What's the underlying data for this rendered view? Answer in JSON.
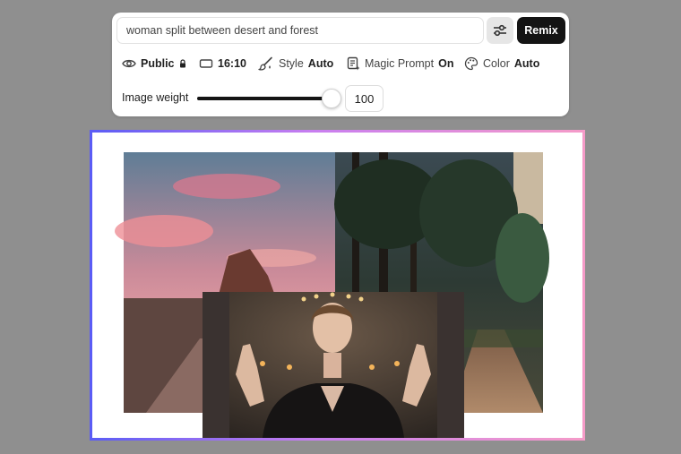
{
  "prompt": {
    "value": "woman split between desert and forest"
  },
  "toolbar": {
    "remix_label": "Remix"
  },
  "options": {
    "visibility": {
      "value": "Public"
    },
    "aspect": {
      "value": "16:10"
    },
    "style": {
      "label": "Style",
      "value": "Auto"
    },
    "magic_prompt": {
      "label": "Magic Prompt",
      "value": "On"
    },
    "color": {
      "label": "Color",
      "value": "Auto"
    }
  },
  "image_weight": {
    "label": "Image weight",
    "value": "100",
    "fraction": 0.94
  },
  "colors": {
    "accent_start": "#5a5cf5",
    "accent_mid": "#c87ef0",
    "accent_end": "#f59bc8",
    "button_dark": "#141414"
  },
  "icons": [
    "eye-icon",
    "lock-icon",
    "aspect-ratio-icon",
    "brush-icon",
    "magic-prompt-icon",
    "palette-icon",
    "sliders-icon"
  ]
}
